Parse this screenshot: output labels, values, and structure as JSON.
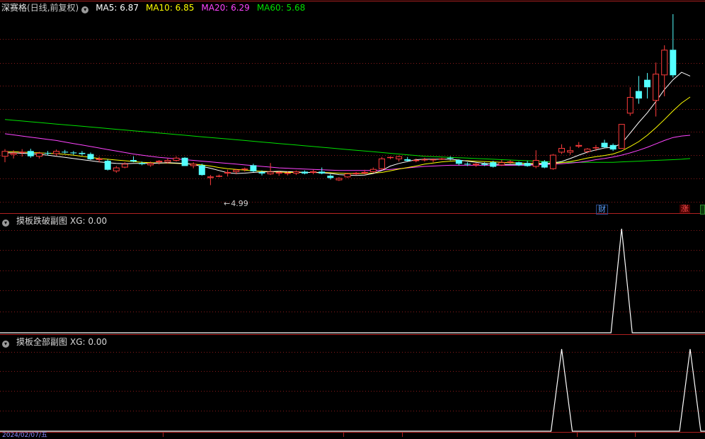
{
  "main_legend": {
    "stock_name": "深赛格",
    "period_label": "(日线,前复权)",
    "ma5": "MA5: 6.87",
    "ma10": "MA10: 6.85",
    "ma20": "MA20: 6.29",
    "ma60": "MA60: 5.68"
  },
  "low_marker": "4.99",
  "badges": {
    "finance": "财",
    "up": "涨"
  },
  "sub1": {
    "title": "摸板跌破副图",
    "value": "XG: 0.00"
  },
  "sub2": {
    "title": "摸板全部副图",
    "value": "XG: 0.00"
  },
  "date_label": "2024/02/07/五",
  "colors": {
    "up": "#ff3c3c",
    "down": "#54ffff",
    "ma5": "#ffffff",
    "ma10": "#ffff00",
    "ma20": "#ff44ff",
    "ma60": "#00e000",
    "grid": "#8a1a1a"
  },
  "chart_data": [
    {
      "type": "candlestick",
      "price_range": [
        4.3,
        9.55
      ],
      "candles": [
        {
          "o": 5.75,
          "h": 5.95,
          "l": 5.6,
          "c": 5.9
        },
        {
          "o": 5.8,
          "h": 5.92,
          "l": 5.7,
          "c": 5.85
        },
        {
          "o": 5.86,
          "h": 5.95,
          "l": 5.75,
          "c": 5.88
        },
        {
          "o": 5.9,
          "h": 5.96,
          "l": 5.72,
          "c": 5.76
        },
        {
          "o": 5.75,
          "h": 5.88,
          "l": 5.7,
          "c": 5.85
        },
        {
          "o": 5.85,
          "h": 5.9,
          "l": 5.78,
          "c": 5.84
        },
        {
          "o": 5.82,
          "h": 5.94,
          "l": 5.78,
          "c": 5.9
        },
        {
          "o": 5.88,
          "h": 5.93,
          "l": 5.83,
          "c": 5.86
        },
        {
          "o": 5.86,
          "h": 5.9,
          "l": 5.8,
          "c": 5.84
        },
        {
          "o": 5.85,
          "h": 5.9,
          "l": 5.78,
          "c": 5.82
        },
        {
          "o": 5.82,
          "h": 5.86,
          "l": 5.66,
          "c": 5.68
        },
        {
          "o": 5.66,
          "h": 5.75,
          "l": 5.6,
          "c": 5.7
        },
        {
          "o": 5.64,
          "h": 5.68,
          "l": 5.38,
          "c": 5.4
        },
        {
          "o": 5.36,
          "h": 5.5,
          "l": 5.32,
          "c": 5.46
        },
        {
          "o": 5.46,
          "h": 5.6,
          "l": 5.44,
          "c": 5.56
        },
        {
          "o": 5.66,
          "h": 5.76,
          "l": 5.6,
          "c": 5.62
        },
        {
          "o": 5.58,
          "h": 5.62,
          "l": 5.52,
          "c": 5.55
        },
        {
          "o": 5.52,
          "h": 5.62,
          "l": 5.48,
          "c": 5.58
        },
        {
          "o": 5.6,
          "h": 5.66,
          "l": 5.54,
          "c": 5.64
        },
        {
          "o": 5.6,
          "h": 5.7,
          "l": 5.56,
          "c": 5.66
        },
        {
          "o": 5.64,
          "h": 5.76,
          "l": 5.62,
          "c": 5.72
        },
        {
          "o": 5.72,
          "h": 5.74,
          "l": 5.5,
          "c": 5.5
        },
        {
          "o": 5.5,
          "h": 5.6,
          "l": 5.44,
          "c": 5.56
        },
        {
          "o": 5.52,
          "h": 5.56,
          "l": 5.24,
          "c": 5.26
        },
        {
          "o": 5.18,
          "h": 5.26,
          "l": 4.99,
          "c": 5.22
        },
        {
          "o": 5.24,
          "h": 5.27,
          "l": 5.2,
          "c": 5.24
        },
        {
          "o": 5.3,
          "h": 5.4,
          "l": 5.22,
          "c": 5.34
        },
        {
          "o": 5.34,
          "h": 5.42,
          "l": 5.28,
          "c": 5.4
        },
        {
          "o": 5.4,
          "h": 5.46,
          "l": 5.35,
          "c": 5.43
        },
        {
          "o": 5.52,
          "h": 5.56,
          "l": 5.34,
          "c": 5.36
        },
        {
          "o": 5.34,
          "h": 5.38,
          "l": 5.25,
          "c": 5.3
        },
        {
          "o": 5.28,
          "h": 5.58,
          "l": 5.26,
          "c": 5.35
        },
        {
          "o": 5.3,
          "h": 5.36,
          "l": 5.24,
          "c": 5.34
        },
        {
          "o": 5.3,
          "h": 5.36,
          "l": 5.25,
          "c": 5.32
        },
        {
          "o": 5.3,
          "h": 5.38,
          "l": 5.26,
          "c": 5.36
        },
        {
          "o": 5.35,
          "h": 5.38,
          "l": 5.28,
          "c": 5.3
        },
        {
          "o": 5.32,
          "h": 5.4,
          "l": 5.28,
          "c": 5.36
        },
        {
          "o": 5.35,
          "h": 5.46,
          "l": 5.28,
          "c": 5.3
        },
        {
          "o": 5.24,
          "h": 5.28,
          "l": 5.14,
          "c": 5.18
        },
        {
          "o": 5.12,
          "h": 5.2,
          "l": 5.1,
          "c": 5.18
        },
        {
          "o": 5.2,
          "h": 5.32,
          "l": 5.18,
          "c": 5.3
        },
        {
          "o": 5.28,
          "h": 5.34,
          "l": 5.26,
          "c": 5.32
        },
        {
          "o": 5.3,
          "h": 5.4,
          "l": 5.28,
          "c": 5.34
        },
        {
          "o": 5.34,
          "h": 5.46,
          "l": 5.32,
          "c": 5.42
        },
        {
          "o": 5.42,
          "h": 5.74,
          "l": 5.4,
          "c": 5.7
        },
        {
          "o": 5.72,
          "h": 5.76,
          "l": 5.68,
          "c": 5.74
        },
        {
          "o": 5.68,
          "h": 5.78,
          "l": 5.62,
          "c": 5.76
        },
        {
          "o": 5.68,
          "h": 5.74,
          "l": 5.62,
          "c": 5.64
        },
        {
          "o": 5.64,
          "h": 5.7,
          "l": 5.6,
          "c": 5.66
        },
        {
          "o": 5.66,
          "h": 5.72,
          "l": 5.62,
          "c": 5.68
        },
        {
          "o": 5.66,
          "h": 5.7,
          "l": 5.6,
          "c": 5.68
        },
        {
          "o": 5.68,
          "h": 5.72,
          "l": 5.66,
          "c": 5.7
        },
        {
          "o": 5.72,
          "h": 5.76,
          "l": 5.65,
          "c": 5.7
        },
        {
          "o": 5.66,
          "h": 5.68,
          "l": 5.52,
          "c": 5.56
        },
        {
          "o": 5.56,
          "h": 5.6,
          "l": 5.5,
          "c": 5.54
        },
        {
          "o": 5.52,
          "h": 5.58,
          "l": 5.48,
          "c": 5.56
        },
        {
          "o": 5.56,
          "h": 5.6,
          "l": 5.5,
          "c": 5.53
        },
        {
          "o": 5.6,
          "h": 5.64,
          "l": 5.46,
          "c": 5.48
        },
        {
          "o": 5.52,
          "h": 5.66,
          "l": 5.5,
          "c": 5.6
        },
        {
          "o": 5.6,
          "h": 5.66,
          "l": 5.56,
          "c": 5.62
        },
        {
          "o": 5.6,
          "h": 5.62,
          "l": 5.5,
          "c": 5.52
        },
        {
          "o": 5.58,
          "h": 5.64,
          "l": 5.48,
          "c": 5.5
        },
        {
          "o": 5.48,
          "h": 5.92,
          "l": 5.44,
          "c": 5.66
        },
        {
          "o": 5.62,
          "h": 5.66,
          "l": 5.44,
          "c": 5.46
        },
        {
          "o": 5.42,
          "h": 5.82,
          "l": 5.4,
          "c": 5.8
        },
        {
          "o": 5.86,
          "h": 6.08,
          "l": 5.82,
          "c": 5.98
        },
        {
          "o": 5.86,
          "h": 6.02,
          "l": 5.8,
          "c": 5.92
        },
        {
          "o": 6.02,
          "h": 6.14,
          "l": 5.98,
          "c": 6.06
        },
        {
          "o": 5.88,
          "h": 5.98,
          "l": 5.84,
          "c": 5.96
        },
        {
          "o": 5.98,
          "h": 6.06,
          "l": 5.9,
          "c": 6.0
        },
        {
          "o": 6.12,
          "h": 6.2,
          "l": 5.98,
          "c": 6.0
        },
        {
          "o": 6.06,
          "h": 6.1,
          "l": 5.9,
          "c": 5.94
        },
        {
          "o": 5.96,
          "h": 6.62,
          "l": 5.96,
          "c": 6.62
        },
        {
          "o": 6.9,
          "h": 7.6,
          "l": 6.84,
          "c": 7.34
        },
        {
          "o": 7.5,
          "h": 7.9,
          "l": 7.16,
          "c": 7.3
        },
        {
          "o": 7.8,
          "h": 7.98,
          "l": 7.3,
          "c": 7.6
        },
        {
          "o": 7.24,
          "h": 8.26,
          "l": 6.82,
          "c": 7.96
        },
        {
          "o": 7.92,
          "h": 8.72,
          "l": 7.36,
          "c": 8.6
        },
        {
          "o": 8.6,
          "h": 9.55,
          "l": 7.86,
          "c": 7.92
        }
      ],
      "ma": {
        "ma5": [
          5.85,
          5.85,
          5.84,
          5.83,
          5.81,
          5.79,
          5.76,
          5.73,
          5.7,
          5.67,
          5.64,
          5.61,
          5.59,
          5.57,
          5.56,
          5.57,
          5.57,
          5.57,
          5.58,
          5.59,
          5.58,
          5.57,
          5.54,
          5.49,
          5.44,
          5.38,
          5.32,
          5.3,
          5.31,
          5.33,
          5.34,
          5.35,
          5.36,
          5.35,
          5.34,
          5.33,
          5.33,
          5.32,
          5.3,
          5.27,
          5.26,
          5.25,
          5.26,
          5.3,
          5.38,
          5.5,
          5.57,
          5.62,
          5.67,
          5.68,
          5.68,
          5.68,
          5.68,
          5.66,
          5.63,
          5.6,
          5.57,
          5.55,
          5.54,
          5.54,
          5.54,
          5.54,
          5.55,
          5.56,
          5.58,
          5.62,
          5.7,
          5.79,
          5.87,
          5.93,
          5.98,
          6.0,
          6.1,
          6.38,
          6.66,
          6.92,
          7.22,
          7.54,
          7.8,
          8.0,
          7.9
        ],
        "ma10": [
          5.88,
          5.88,
          5.87,
          5.86,
          5.85,
          5.84,
          5.83,
          5.81,
          5.79,
          5.76,
          5.73,
          5.7,
          5.68,
          5.66,
          5.64,
          5.62,
          5.6,
          5.59,
          5.58,
          5.58,
          5.57,
          5.56,
          5.55,
          5.53,
          5.5,
          5.46,
          5.43,
          5.41,
          5.39,
          5.37,
          5.36,
          5.35,
          5.34,
          5.33,
          5.33,
          5.33,
          5.33,
          5.33,
          5.32,
          5.31,
          5.3,
          5.3,
          5.3,
          5.31,
          5.33,
          5.37,
          5.42,
          5.46,
          5.5,
          5.55,
          5.58,
          5.61,
          5.63,
          5.64,
          5.64,
          5.63,
          5.62,
          5.61,
          5.6,
          5.59,
          5.58,
          5.57,
          5.57,
          5.57,
          5.57,
          5.59,
          5.62,
          5.66,
          5.71,
          5.75,
          5.78,
          5.82,
          5.9,
          6.02,
          6.15,
          6.32,
          6.52,
          6.74,
          6.97,
          7.18,
          7.34
        ],
        "ma20": [
          6.36,
          6.33,
          6.3,
          6.27,
          6.24,
          6.21,
          6.18,
          6.14,
          6.1,
          6.06,
          6.02,
          5.98,
          5.94,
          5.9,
          5.86,
          5.82,
          5.79,
          5.76,
          5.73,
          5.71,
          5.69,
          5.67,
          5.65,
          5.63,
          5.61,
          5.59,
          5.57,
          5.55,
          5.53,
          5.51,
          5.49,
          5.47,
          5.45,
          5.44,
          5.43,
          5.42,
          5.41,
          5.4,
          5.39,
          5.38,
          5.38,
          5.38,
          5.38,
          5.38,
          5.39,
          5.41,
          5.43,
          5.45,
          5.47,
          5.49,
          5.5,
          5.51,
          5.52,
          5.52,
          5.52,
          5.52,
          5.52,
          5.52,
          5.52,
          5.52,
          5.52,
          5.52,
          5.53,
          5.54,
          5.55,
          5.56,
          5.58,
          5.6,
          5.63,
          5.67,
          5.7,
          5.74,
          5.79,
          5.85,
          5.92,
          6.0,
          6.09,
          6.18,
          6.26,
          6.3,
          6.32
        ],
        "ma60": [
          6.74,
          6.72,
          6.7,
          6.68,
          6.66,
          6.64,
          6.62,
          6.6,
          6.58,
          6.56,
          6.54,
          6.52,
          6.5,
          6.48,
          6.46,
          6.44,
          6.42,
          6.4,
          6.38,
          6.36,
          6.34,
          6.32,
          6.3,
          6.28,
          6.26,
          6.24,
          6.22,
          6.2,
          6.18,
          6.16,
          6.14,
          6.12,
          6.1,
          6.08,
          6.06,
          6.04,
          6.02,
          6.0,
          5.98,
          5.96,
          5.94,
          5.92,
          5.9,
          5.88,
          5.86,
          5.84,
          5.82,
          5.8,
          5.78,
          5.76,
          5.75,
          5.74,
          5.73,
          5.72,
          5.71,
          5.7,
          5.69,
          5.68,
          5.67,
          5.66,
          5.65,
          5.64,
          5.63,
          5.62,
          5.61,
          5.6,
          5.6,
          5.6,
          5.6,
          5.6,
          5.6,
          5.6,
          5.61,
          5.62,
          5.63,
          5.64,
          5.65,
          5.66,
          5.67,
          5.68,
          5.7
        ]
      }
    },
    {
      "type": "line",
      "series_title": "XG",
      "ylim": [
        0,
        1
      ],
      "peaks_at": [
        72
      ],
      "candle_count": 81
    },
    {
      "type": "line",
      "series_title": "XG",
      "ylim": [
        0,
        1
      ],
      "peaks_at": [
        65,
        80
      ],
      "candle_count": 81
    }
  ]
}
